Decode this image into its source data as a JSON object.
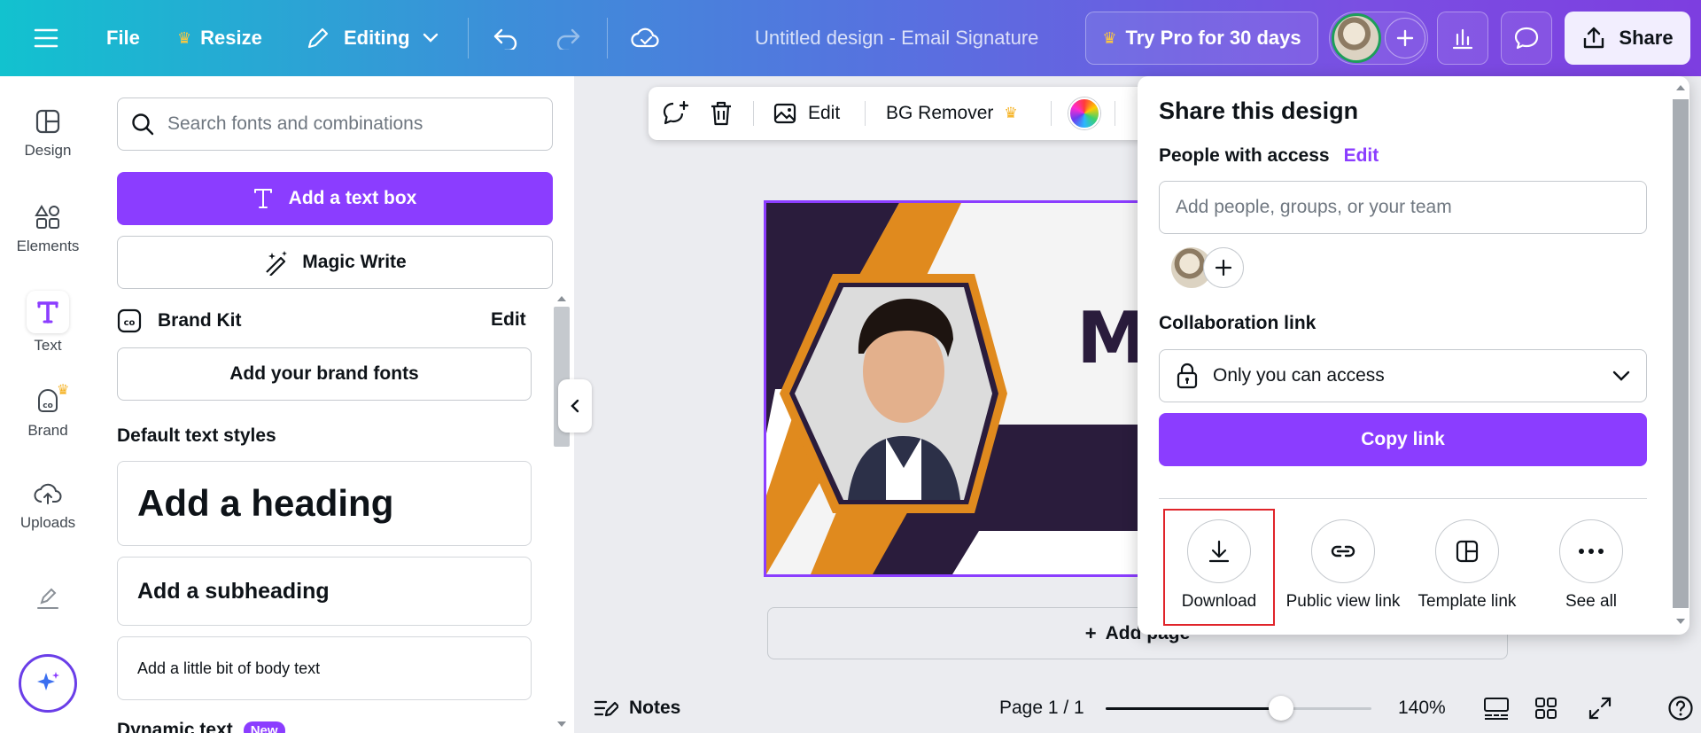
{
  "topbar": {
    "file_label": "File",
    "resize_label": "Resize",
    "editing_label": "Editing",
    "doc_title": "Untitled design - Email Signature",
    "try_pro_label": "Try Pro for 30 days",
    "share_label": "Share"
  },
  "rail": {
    "items": [
      {
        "label": "Design",
        "icon": "layout-icon"
      },
      {
        "label": "Elements",
        "icon": "shapes-icon"
      },
      {
        "label": "Text",
        "icon": "text-icon"
      },
      {
        "label": "Brand",
        "icon": "brand-icon"
      },
      {
        "label": "Uploads",
        "icon": "cloud-upload-icon"
      }
    ]
  },
  "panel": {
    "search_placeholder": "Search fonts and combinations",
    "add_text_box": "Add a text box",
    "magic_write": "Magic Write",
    "brand_kit_label": "Brand Kit",
    "brand_kit_edit": "Edit",
    "add_brand_fonts": "Add your brand fonts",
    "default_styles_label": "Default text styles",
    "heading": "Add a heading",
    "subheading": "Add a subheading",
    "body": "Add a little bit of body text",
    "dynamic_text_label": "Dynamic text",
    "new_badge": "New"
  },
  "toolbar": {
    "edit_label": "Edit",
    "bg_remover_label": "BG Remover"
  },
  "canvas": {
    "add_page_label": "Add page",
    "design_letter": "M"
  },
  "footer": {
    "notes_label": "Notes",
    "page_label": "Page 1 / 1",
    "zoom_label": "140%",
    "zoom_fraction": 0.66
  },
  "share": {
    "title": "Share this design",
    "people_label": "People with access",
    "people_edit": "Edit",
    "add_people_placeholder": "Add people, groups, or your team",
    "collab_label": "Collaboration link",
    "access_value": "Only you can access",
    "copy_link_label": "Copy link",
    "options": [
      {
        "label": "Download",
        "icon": "download-icon"
      },
      {
        "label": "Public view link",
        "icon": "link-icon"
      },
      {
        "label": "Template link",
        "icon": "template-icon"
      },
      {
        "label": "See all",
        "icon": "more-icon"
      }
    ]
  },
  "colors": {
    "accent": "#8b3dff",
    "design_navy": "#2a1c3c",
    "design_orange": "#e08a1e",
    "highlight": "#e0242a"
  }
}
